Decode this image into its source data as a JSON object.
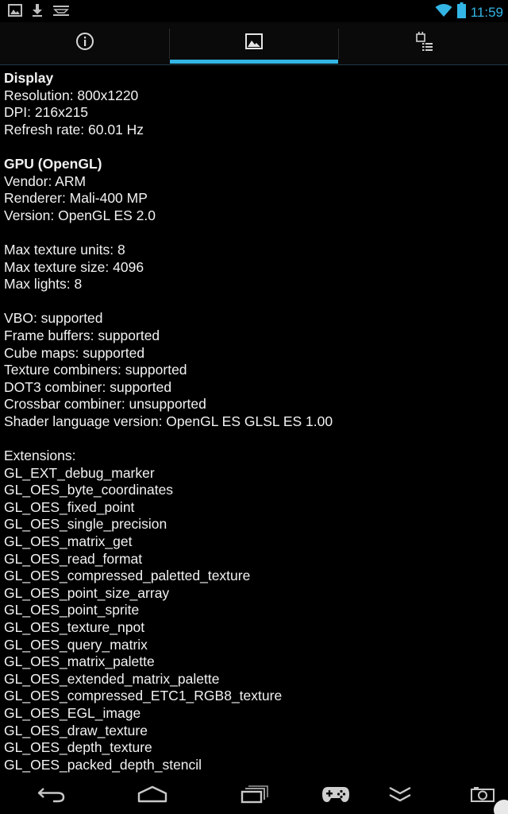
{
  "status_bar": {
    "time": "11:59",
    "left_icons": [
      "image-notification-icon",
      "download-icon",
      "usb-icon"
    ],
    "right_icons": [
      "wifi-icon",
      "battery-icon"
    ]
  },
  "tabs": [
    {
      "icon": "info-icon",
      "selected": false
    },
    {
      "icon": "display-image-icon",
      "selected": true
    },
    {
      "icon": "sensor-list-icon",
      "selected": false
    }
  ],
  "accent_color": "#33b5e5",
  "content": {
    "lines": [
      {
        "text": "Display",
        "header": true
      },
      {
        "text": "Resolution: 800x1220"
      },
      {
        "text": "DPI: 216x215"
      },
      {
        "text": "Refresh rate: 60.01 Hz"
      },
      {
        "text": ""
      },
      {
        "text": "GPU (OpenGL)",
        "header": true
      },
      {
        "text": "Vendor: ARM"
      },
      {
        "text": "Renderer: Mali-400 MP"
      },
      {
        "text": "Version: OpenGL ES 2.0"
      },
      {
        "text": ""
      },
      {
        "text": "Max texture units: 8"
      },
      {
        "text": "Max texture size: 4096"
      },
      {
        "text": "Max lights: 8"
      },
      {
        "text": ""
      },
      {
        "text": "VBO: supported"
      },
      {
        "text": "Frame buffers: supported"
      },
      {
        "text": "Cube maps: supported"
      },
      {
        "text": "Texture combiners: supported"
      },
      {
        "text": "DOT3 combiner: supported"
      },
      {
        "text": "Crossbar combiner: unsupported"
      },
      {
        "text": "Shader language version: OpenGL ES GLSL ES 1.00"
      },
      {
        "text": ""
      },
      {
        "text": "Extensions:"
      },
      {
        "text": "GL_EXT_debug_marker"
      },
      {
        "text": "GL_OES_byte_coordinates"
      },
      {
        "text": "GL_OES_fixed_point"
      },
      {
        "text": "GL_OES_single_precision"
      },
      {
        "text": "GL_OES_matrix_get"
      },
      {
        "text": "GL_OES_read_format"
      },
      {
        "text": "GL_OES_compressed_paletted_texture"
      },
      {
        "text": "GL_OES_point_size_array"
      },
      {
        "text": "GL_OES_point_sprite"
      },
      {
        "text": "GL_OES_texture_npot"
      },
      {
        "text": "GL_OES_query_matrix"
      },
      {
        "text": "GL_OES_matrix_palette"
      },
      {
        "text": "GL_OES_extended_matrix_palette"
      },
      {
        "text": "GL_OES_compressed_ETC1_RGB8_texture"
      },
      {
        "text": "GL_OES_EGL_image"
      },
      {
        "text": "GL_OES_draw_texture"
      },
      {
        "text": "GL_OES_depth_texture"
      },
      {
        "text": "GL_OES_packed_depth_stencil"
      }
    ]
  },
  "nav_bar": {
    "buttons": [
      "back-icon",
      "home-icon",
      "recent-apps-icon",
      "gamepad-icon",
      "menu-collapse-icon",
      "screenshot-icon"
    ]
  }
}
